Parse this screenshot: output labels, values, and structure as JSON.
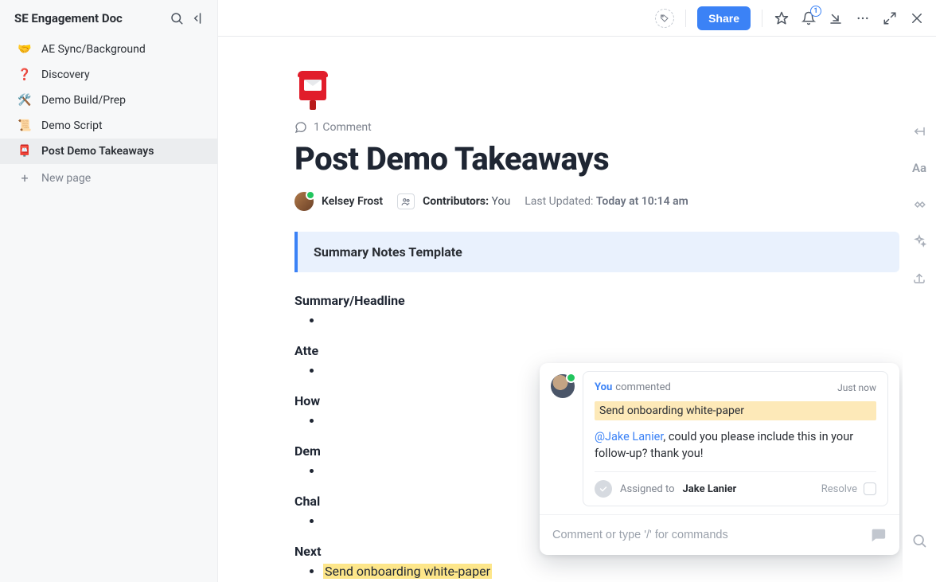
{
  "sidebar": {
    "title": "SE Engagement Doc",
    "items": [
      {
        "emoji": "🤝",
        "label": "AE Sync/Background"
      },
      {
        "emoji": "❓",
        "label": "Discovery"
      },
      {
        "emoji": "🛠️",
        "label": "Demo Build/Prep"
      },
      {
        "emoji": "📜",
        "label": "Demo Script"
      },
      {
        "emoji": "📮",
        "label": "Post Demo Takeaways"
      }
    ],
    "new_page_label": "New page"
  },
  "topbar": {
    "share_label": "Share",
    "bell_badge": "1"
  },
  "doc": {
    "comment_count_label": "1 Comment",
    "title": "Post Demo Takeaways",
    "author_name": "Kelsey Frost",
    "contributors_label": "Contributors:",
    "contributors_value": "You",
    "updated_label": "Last Updated:",
    "updated_value": "Today at 10:14 am",
    "callout_title": "Summary Notes Template",
    "sections": [
      "Summary/Headline",
      "Atte",
      "How",
      "Dem",
      "Chal",
      "Next"
    ],
    "next_step_item": "Send onboarding white-paper"
  },
  "popover": {
    "you_label": "You",
    "action_label": "commented",
    "timestamp": "Just now",
    "quoted_text": "Send onboarding white-paper",
    "mention": "@Jake Lanier",
    "body_rest": ", could you please include this in your follow-up? thank you!",
    "assigned_to_label": "Assigned to",
    "assignee": "Jake Lanier",
    "resolve_label": "Resolve",
    "input_placeholder": "Comment or type '/' for commands"
  }
}
